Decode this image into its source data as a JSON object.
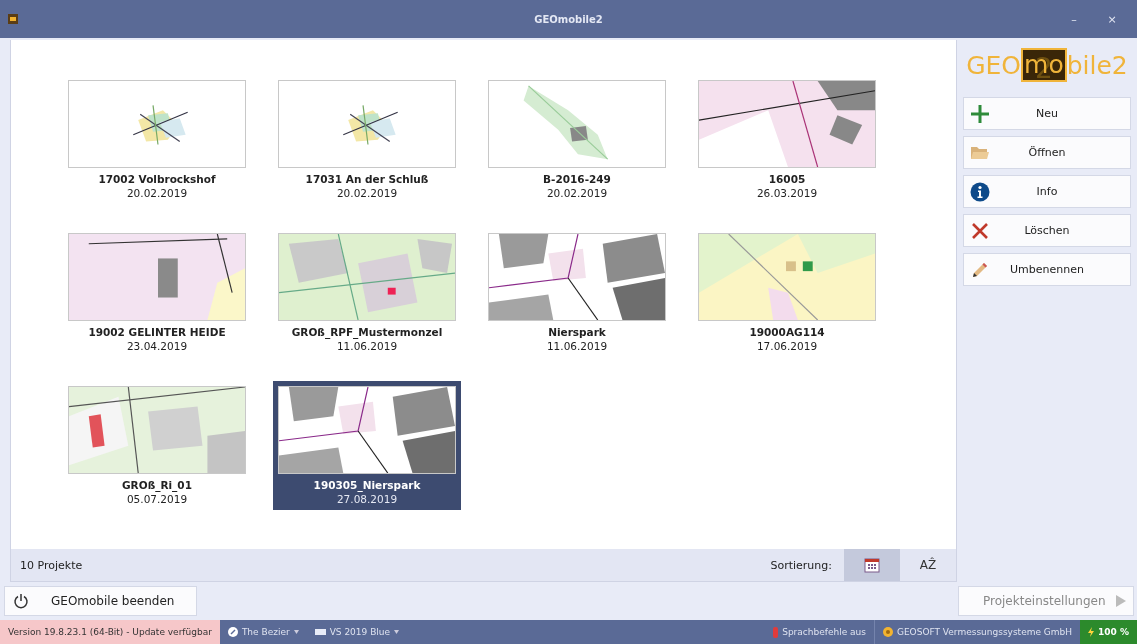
{
  "window": {
    "title": "GEOmobile2",
    "controls": [
      "–",
      "×"
    ]
  },
  "projects": [
    {
      "name": "17002 Volbrockshof",
      "date": "20.02.2019",
      "selected": false
    },
    {
      "name": "17031 An der Schluß",
      "date": "20.02.2019",
      "selected": false
    },
    {
      "name": "B-2016-249",
      "date": "20.02.2019",
      "selected": false
    },
    {
      "name": "16005",
      "date": "26.03.2019",
      "selected": false
    },
    {
      "name": "19002 GELINTER HEIDE",
      "date": "23.04.2019",
      "selected": false
    },
    {
      "name": "GROß_RPF_Mustermonzel",
      "date": "11.06.2019",
      "selected": false
    },
    {
      "name": "Nierspark",
      "date": "11.06.2019",
      "selected": false
    },
    {
      "name": "19000AG114",
      "date": "17.06.2019",
      "selected": false
    },
    {
      "name": "GROß_Ri_01",
      "date": "05.07.2019",
      "selected": false
    },
    {
      "name": "190305_Nierspark",
      "date": "27.08.2019",
      "selected": true
    }
  ],
  "footer": {
    "count": "10 Projekte",
    "sort_label": "Sortierung:",
    "sort_options": [
      {
        "kind": "date",
        "selected": true
      },
      {
        "kind": "alpha",
        "label": "AẐ",
        "selected": false
      }
    ]
  },
  "logo": {
    "parts": [
      "GEO",
      "mo",
      "bile2"
    ],
    "mark": "2"
  },
  "actions": [
    {
      "kind": "add",
      "label": "Neu"
    },
    {
      "kind": "open",
      "label": "Öffnen"
    },
    {
      "kind": "info",
      "label": "Info"
    },
    {
      "kind": "delete",
      "label": "Löschen"
    },
    {
      "kind": "rename",
      "label": "Umbenennen"
    }
  ],
  "quit_button": "GEOmobile beenden",
  "settings_button": {
    "label": "Projekteinstellungen",
    "disabled": true
  },
  "status_bar": {
    "version": "Version 19.8.23.1 (64-Bit) - Update verfügbar",
    "theme": "The Bezier",
    "style": "VS 2019 Blue",
    "voice": "Sprachbefehle aus",
    "company": "GEOSOFT Vermessungssysteme GmbH",
    "battery": "100 %"
  }
}
